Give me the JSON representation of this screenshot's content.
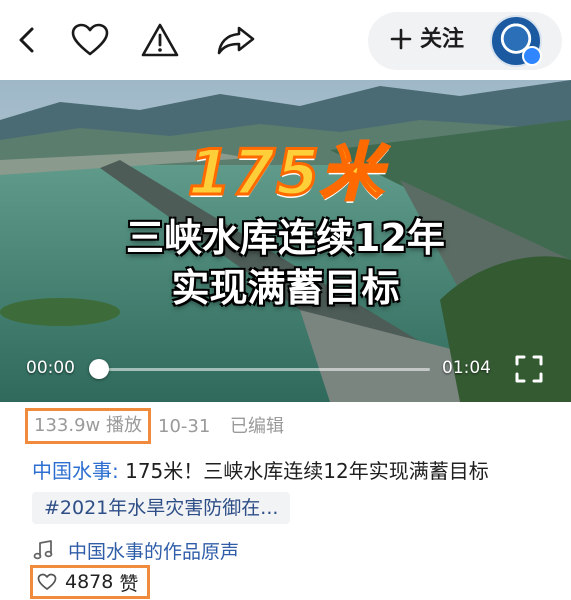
{
  "header": {
    "follow_label": "关注",
    "icons": [
      "back-arrow-icon",
      "heart-icon",
      "warning-report-icon",
      "share-arrow-icon",
      "plus-icon"
    ]
  },
  "video": {
    "overlay_number": "175米",
    "overlay_line1": "三峡水库连续12年",
    "overlay_line2": "实现满蓄目标",
    "time_current": "00:00",
    "time_total": "01:04",
    "progress_fraction": 0.0
  },
  "meta": {
    "views": "133.9w 播放",
    "date": "10-31",
    "edited": "已编辑"
  },
  "post": {
    "author": "中国水事:",
    "title": " 175米！三峡水库连续12年实现满蓄目标",
    "tag": "#2021年水旱灾害防御在..."
  },
  "sound": {
    "label": "中国水事的作品原声"
  },
  "likes": {
    "count": "4878",
    "unit": "赞"
  },
  "colors": {
    "highlight_box": "#f08a3c",
    "link_blue": "#2d6fd0",
    "number_yellow": "#ffcf3a"
  }
}
